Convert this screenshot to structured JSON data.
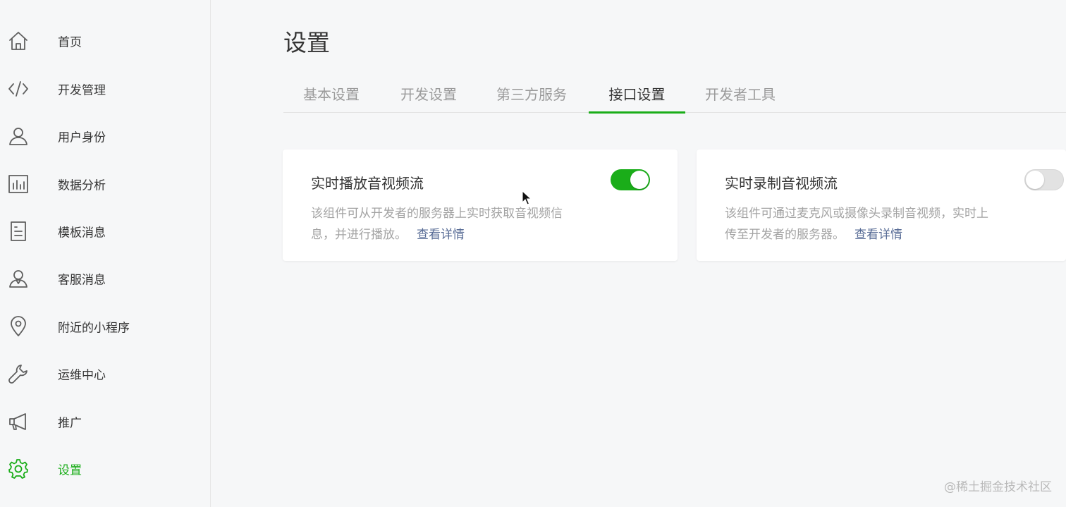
{
  "sidebar": {
    "items": [
      {
        "label": "首页",
        "icon": "home-icon"
      },
      {
        "label": "开发管理",
        "icon": "code-icon"
      },
      {
        "label": "用户身份",
        "icon": "user-icon"
      },
      {
        "label": "数据分析",
        "icon": "bar-chart-icon"
      },
      {
        "label": "模板消息",
        "icon": "document-icon"
      },
      {
        "label": "客服消息",
        "icon": "customer-service-icon"
      },
      {
        "label": "附近的小程序",
        "icon": "location-pin-icon"
      },
      {
        "label": "运维中心",
        "icon": "wrench-icon"
      },
      {
        "label": "推广",
        "icon": "megaphone-icon"
      },
      {
        "label": "设置",
        "icon": "gear-icon",
        "active": true
      }
    ]
  },
  "main": {
    "title": "设置",
    "tabs": [
      {
        "label": "基本设置"
      },
      {
        "label": "开发设置"
      },
      {
        "label": "第三方服务"
      },
      {
        "label": "接口设置",
        "active": true
      },
      {
        "label": "开发者工具"
      }
    ],
    "cards": [
      {
        "title": "实时播放音视频流",
        "desc": "该组件可从开发者的服务器上实时获取音视频信息，并进行播放。",
        "link": "查看详情",
        "enabled": true
      },
      {
        "title": "实时录制音视频流",
        "desc": "该组件可通过麦克风或摄像头录制音视频，实时上传至开发者的服务器。",
        "link": "查看详情",
        "enabled": false
      }
    ]
  },
  "watermark": "@稀土掘金技术社区",
  "colors": {
    "accent": "#1aad19",
    "link": "#576b95",
    "muted_text": "#a3a3a3"
  }
}
